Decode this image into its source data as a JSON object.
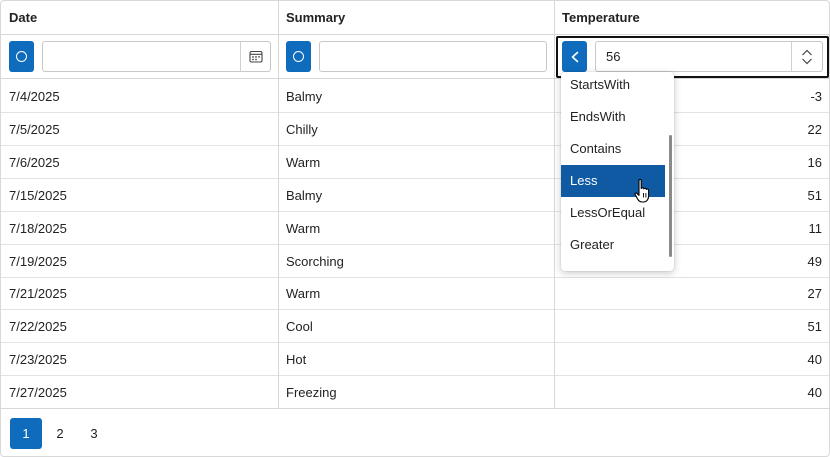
{
  "columns": {
    "date": "Date",
    "summary": "Summary",
    "temperature": "Temperature"
  },
  "filters": {
    "date": {
      "value": "",
      "mode_icon": "circle-icon",
      "picker_icon": "calendar-icon"
    },
    "summary": {
      "value": "",
      "mode_icon": "circle-icon"
    },
    "temperature": {
      "value": "56",
      "mode_icon": "less-than-icon",
      "spinner_icons": [
        "chevron-up-icon",
        "chevron-down-icon"
      ]
    }
  },
  "rows": [
    {
      "date": "7/4/2025",
      "summary": "Balmy",
      "temperature": "-3"
    },
    {
      "date": "7/5/2025",
      "summary": "Chilly",
      "temperature": "22"
    },
    {
      "date": "7/6/2025",
      "summary": "Warm",
      "temperature": "16"
    },
    {
      "date": "7/15/2025",
      "summary": "Balmy",
      "temperature": "51"
    },
    {
      "date": "7/18/2025",
      "summary": "Warm",
      "temperature": "11"
    },
    {
      "date": "7/19/2025",
      "summary": "Scorching",
      "temperature": "49"
    },
    {
      "date": "7/21/2025",
      "summary": "Warm",
      "temperature": "27"
    },
    {
      "date": "7/22/2025",
      "summary": "Cool",
      "temperature": "51"
    },
    {
      "date": "7/23/2025",
      "summary": "Hot",
      "temperature": "40"
    },
    {
      "date": "7/27/2025",
      "summary": "Freezing",
      "temperature": "40"
    }
  ],
  "filter_menu": {
    "options": [
      "StartsWith",
      "EndsWith",
      "Contains",
      "Less",
      "LessOrEqual",
      "Greater"
    ],
    "selected": "Less"
  },
  "pager": {
    "pages": [
      "1",
      "2",
      "3"
    ],
    "current": "1"
  },
  "colors": {
    "accent": "#0f6cbd",
    "selected_option": "#0f5aa3",
    "border": "#d8d8d8"
  }
}
